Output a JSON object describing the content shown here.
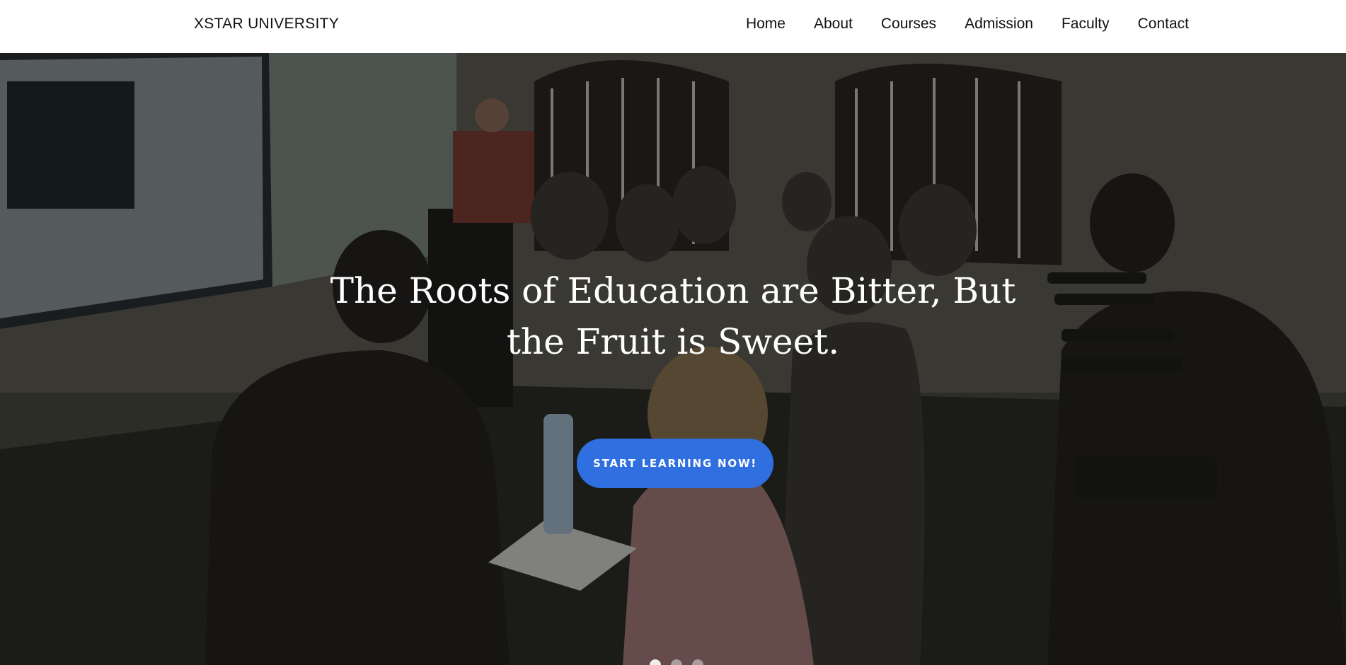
{
  "brand": "XSTAR UNIVERSITY",
  "nav": {
    "items": [
      "Home",
      "About",
      "Courses",
      "Admission",
      "Faculty",
      "Contact"
    ]
  },
  "hero": {
    "headline": "The Roots of Education are Bitter, But the Fruit is Sweet.",
    "cta_label": "START LEARNING NOW!",
    "cta_color": "#2f6fe0",
    "slides": 3,
    "active_slide": 1
  }
}
